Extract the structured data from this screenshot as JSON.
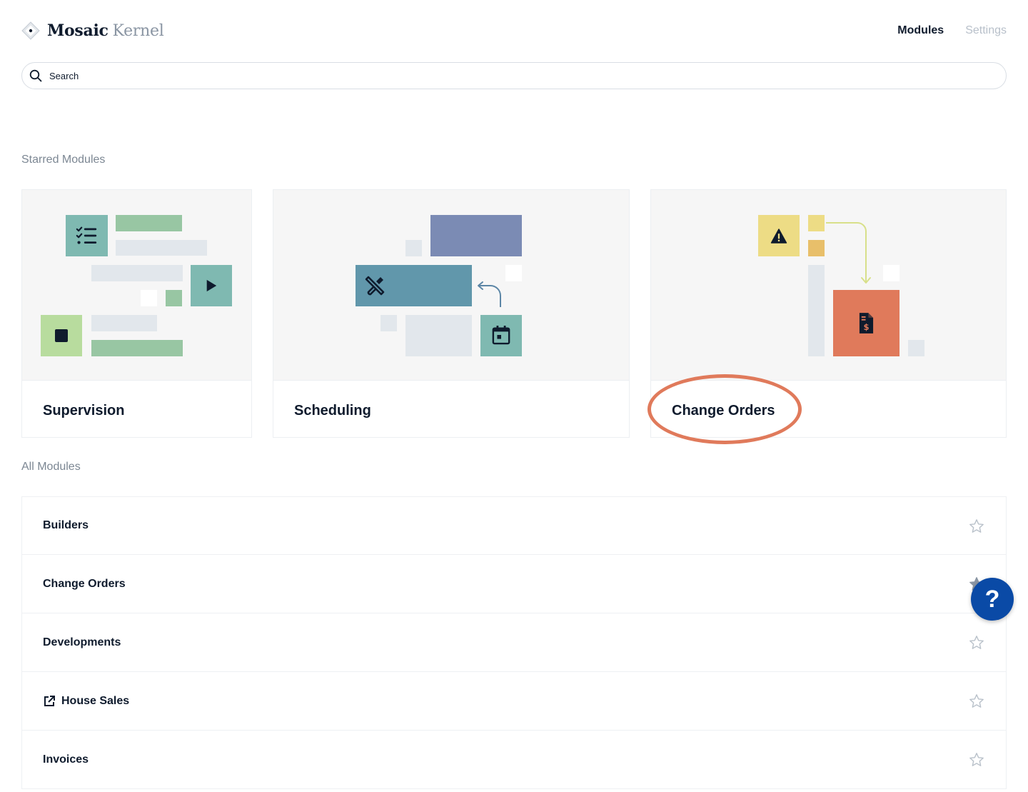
{
  "header": {
    "brand_primary": "Mosaic",
    "brand_secondary": "Kernel",
    "nav": {
      "modules": "Modules",
      "settings": "Settings"
    }
  },
  "search": {
    "placeholder": "Search"
  },
  "starred": {
    "label": "Starred Modules",
    "cards": [
      {
        "title": "Supervision"
      },
      {
        "title": "Scheduling"
      },
      {
        "title": "Change Orders"
      }
    ]
  },
  "all": {
    "label": "All Modules",
    "rows": [
      {
        "label": "Builders"
      },
      {
        "label": "Change Orders"
      },
      {
        "label": "Developments"
      },
      {
        "label": "House Sales",
        "external": true
      },
      {
        "label": "Invoices"
      }
    ]
  },
  "help": {
    "label": "?"
  },
  "colors": {
    "accent_teal": "#7fb9b1",
    "accent_green": "#98c6a3",
    "accent_lightgreen": "#b8dc9e",
    "accent_slate": "#7b8bb4",
    "accent_blueteal": "#6197ab",
    "accent_yellow": "#eddc85",
    "accent_orange": "#e07a5b",
    "help_blue": "#0a4aa6"
  }
}
